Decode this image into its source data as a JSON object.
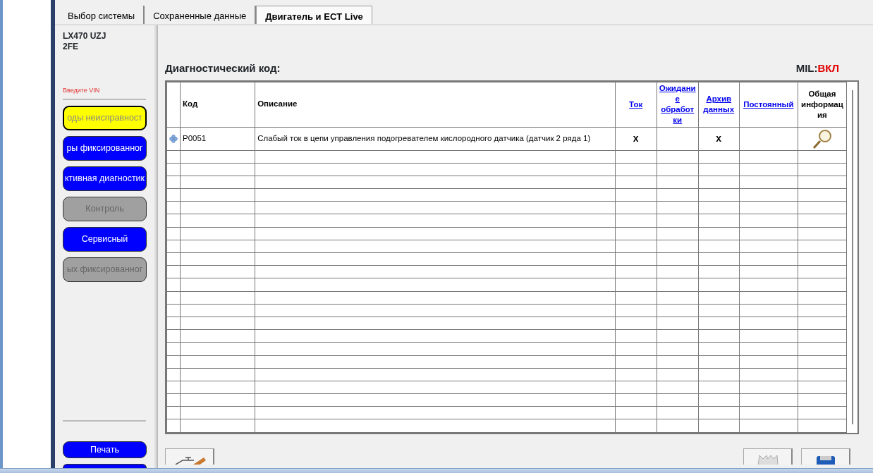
{
  "tabs": [
    {
      "label": "Выбор системы",
      "selected": false
    },
    {
      "label": "Сохраненные данные",
      "selected": false
    },
    {
      "label": "Двигатель и ECT Live",
      "selected": true
    }
  ],
  "vehicle": {
    "model": "LX470 UZJ",
    "engine": "2FE"
  },
  "vin_prompt": "Введите VIN",
  "sidebar_buttons": [
    {
      "label": "оды неисправност",
      "selected": true,
      "disabled": false
    },
    {
      "label": "ры фиксированног",
      "selected": false,
      "disabled": false
    },
    {
      "label": "ктивная диагностик",
      "selected": false,
      "disabled": false
    },
    {
      "label": "Контроль",
      "selected": false,
      "disabled": true
    },
    {
      "label": "Сервисный",
      "selected": false,
      "disabled": false
    },
    {
      "label": "ых фиксированног",
      "selected": false,
      "disabled": true
    }
  ],
  "print_button": "Печать",
  "title": "Диагностический код:",
  "mil": {
    "label": "MIL:",
    "value": "ВКЛ"
  },
  "table": {
    "columns": [
      {
        "label": "Код",
        "kind": "text"
      },
      {
        "label": "Описание",
        "kind": "text"
      },
      {
        "label": "Ток",
        "kind": "link"
      },
      {
        "label": "Ожидание обработки",
        "kind": "link"
      },
      {
        "label": "Архив данных",
        "kind": "link"
      },
      {
        "label": "Постоянный",
        "kind": "link"
      },
      {
        "label": "Общая информация",
        "kind": "text"
      }
    ],
    "rows": [
      {
        "code": "P0051",
        "description": "Слабый ток в цепи управления подогревателем кислородного датчика (датчик 2 ряда 1)",
        "current": "x",
        "pending": "",
        "history": "x",
        "permanent": ""
      }
    ]
  }
}
